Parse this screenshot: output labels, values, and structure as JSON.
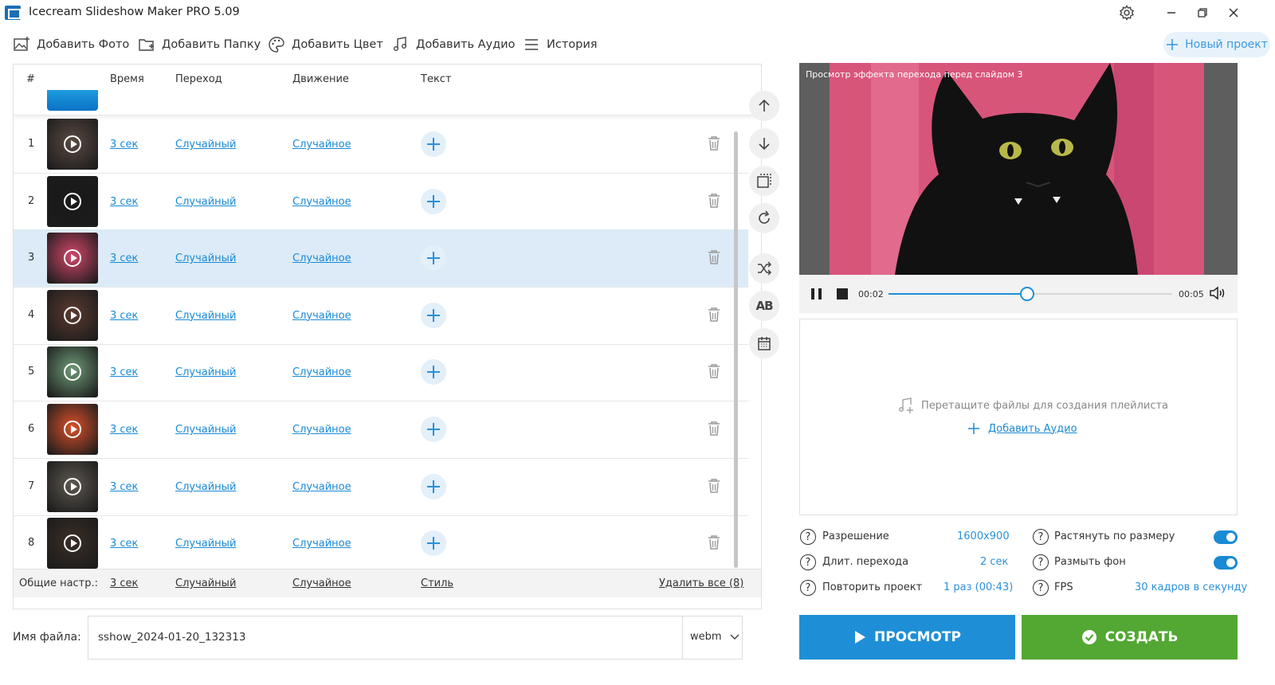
{
  "app": {
    "title": "Icecream Slideshow Maker PRO 5.09"
  },
  "toolbar": {
    "add_photo": "Добавить Фото",
    "add_folder": "Добавить Папку",
    "add_color": "Добавить Цвет",
    "add_audio": "Добавить Аудио",
    "history": "История",
    "new_project": "Новый проект"
  },
  "table": {
    "headers": {
      "num": "#",
      "time": "Время",
      "transition": "Переход",
      "motion": "Движение",
      "text": "Текст"
    },
    "rows": [
      {
        "num": "1",
        "time": "3 сек",
        "transition": "Случайный",
        "motion": "Случайное",
        "thumb_color": "#5a4a42"
      },
      {
        "num": "2",
        "time": "3 сек",
        "transition": "Случайный",
        "motion": "Случайное",
        "thumb_color": "#1a1a1a"
      },
      {
        "num": "3",
        "time": "3 сек",
        "transition": "Случайный",
        "motion": "Случайное",
        "thumb_color": "#d2476a"
      },
      {
        "num": "4",
        "time": "3 сек",
        "transition": "Случайный",
        "motion": "Случайное",
        "thumb_color": "#5b3a30"
      },
      {
        "num": "5",
        "time": "3 сек",
        "transition": "Случайный",
        "motion": "Случайное",
        "thumb_color": "#6e9a77"
      },
      {
        "num": "6",
        "time": "3 сек",
        "transition": "Случайный",
        "motion": "Случайное",
        "thumb_color": "#d9502a"
      },
      {
        "num": "7",
        "time": "3 сек",
        "transition": "Случайный",
        "motion": "Случайное",
        "thumb_color": "#5e5850"
      },
      {
        "num": "8",
        "time": "3 сек",
        "transition": "Случайный",
        "motion": "Случайное",
        "thumb_color": "#3a2e26"
      }
    ],
    "selected_row": "3",
    "footer": {
      "label": "Общие настр.:",
      "time": "3 сек",
      "transition": "Случайный",
      "motion": "Случайное",
      "style": "Стиль",
      "delete_all": "Удалить все (8)"
    }
  },
  "file": {
    "label": "Имя файла:",
    "name": "sshow_2024-01-20_132313",
    "format": "webm"
  },
  "preview": {
    "caption": "Просмотр эффекта перехода перед слайдом 3",
    "current_time": "00:02",
    "total_time": "00:05",
    "progress": 0.49
  },
  "playlist": {
    "hint": "Перетащите файлы для создания плейлиста",
    "add_audio": "Добавить Аудио"
  },
  "settings": {
    "resolution_label": "Разрешение",
    "resolution_value": "1600x900",
    "transition_len_label": "Длит. перехода",
    "transition_len_value": "2 сек",
    "repeat_label": "Повторить проект",
    "repeat_value": "1 раз (00:43)",
    "stretch_label": "Растянуть по размеру",
    "blur_label": "Размыть фон",
    "fps_label": "FPS",
    "fps_value": "30 кадров в секунду"
  },
  "actions": {
    "preview": "ПРОСМОТР",
    "create": "СОЗДАТЬ"
  },
  "colors": {
    "accent": "#1e8fd6",
    "create": "#52a832",
    "selected_row": "#dcebf7",
    "link": "#1a8ad4"
  }
}
